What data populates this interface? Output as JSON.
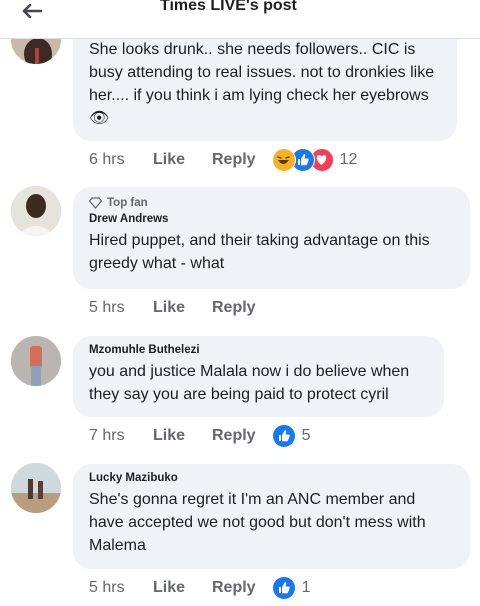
{
  "header": {
    "title": "Times LIVE's post"
  },
  "comments": [
    {
      "author": "",
      "text": "She looks drunk..  she needs followers.. CIC is busy  attending  to real issues. not to dronkies like her.... if you think i am lying check her eyebrows 👁",
      "time": "6 hrs",
      "like": "Like",
      "reply": "Reply",
      "reactions": [
        "haha-icon",
        "like-icon",
        "love-icon"
      ],
      "reaction_count": "12"
    },
    {
      "badge": "Top fan",
      "author": "Drew Andrews",
      "text": "Hired puppet, and their taking advantage on this greedy what - what",
      "time": "5 hrs",
      "like": "Like",
      "reply": "Reply"
    },
    {
      "author": "Mzomuhle Buthelezi",
      "text": "you and justice Malala now i do believe when they say you are being paid to protect cyril",
      "time": "7 hrs",
      "like": "Like",
      "reply": "Reply",
      "reactions": [
        "like-icon"
      ],
      "reaction_count": "5"
    },
    {
      "author": "Lucky Mazibuko",
      "text": "She's gonna regret it I'm an ANC member and have accepted we not good but don't mess with Malema",
      "time": "5 hrs",
      "like": "Like",
      "reply": "Reply",
      "reactions": [
        "like-icon"
      ],
      "reaction_count": "1"
    }
  ],
  "colors": {
    "accent": "#1877f2",
    "love": "#f33e58",
    "haha": "#f7b125",
    "bubble": "#f0f2f5",
    "muted": "#65676b"
  }
}
